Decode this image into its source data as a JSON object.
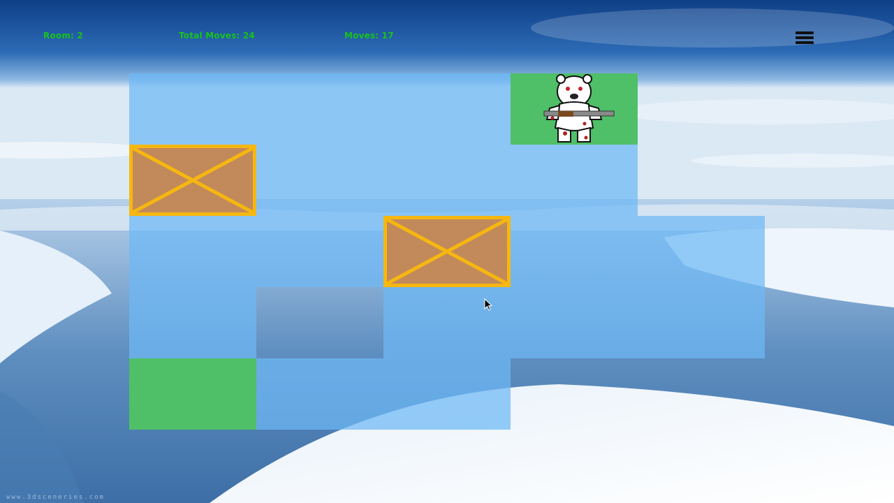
{
  "hud": {
    "room": "Room: 2",
    "total_moves": "Total Moves: 24",
    "moves": "Moves: 17"
  },
  "menu_icon": "hamburger-menu-icon",
  "board": {
    "columns": 5,
    "rows": 5,
    "cells": [
      {
        "col": 0,
        "row": 0,
        "type": "floor"
      },
      {
        "col": 1,
        "row": 0,
        "type": "floor"
      },
      {
        "col": 2,
        "row": 0,
        "type": "floor"
      },
      {
        "col": 3,
        "row": 0,
        "type": "player"
      },
      {
        "col": 0,
        "row": 1,
        "type": "crate"
      },
      {
        "col": 1,
        "row": 1,
        "type": "floor"
      },
      {
        "col": 2,
        "row": 1,
        "type": "floor"
      },
      {
        "col": 3,
        "row": 1,
        "type": "floor"
      },
      {
        "col": 0,
        "row": 2,
        "type": "floor"
      },
      {
        "col": 1,
        "row": 2,
        "type": "floor"
      },
      {
        "col": 2,
        "row": 2,
        "type": "crate"
      },
      {
        "col": 3,
        "row": 2,
        "type": "floor"
      },
      {
        "col": 4,
        "row": 2,
        "type": "floor"
      },
      {
        "col": 0,
        "row": 3,
        "type": "floor"
      },
      {
        "col": 2,
        "row": 3,
        "type": "floor"
      },
      {
        "col": 3,
        "row": 3,
        "type": "floor"
      },
      {
        "col": 4,
        "row": 3,
        "type": "floor"
      },
      {
        "col": 0,
        "row": 4,
        "type": "goal"
      },
      {
        "col": 1,
        "row": 4,
        "type": "floor"
      },
      {
        "col": 2,
        "row": 4,
        "type": "floor"
      }
    ]
  },
  "colors": {
    "hud_text": "#19c21c",
    "floor": "#6eb9f5",
    "goal": "#4fbf68",
    "crate_fill": "#c28a5a",
    "crate_border": "#f6b710"
  },
  "watermark": "www.3dsceneries.com"
}
